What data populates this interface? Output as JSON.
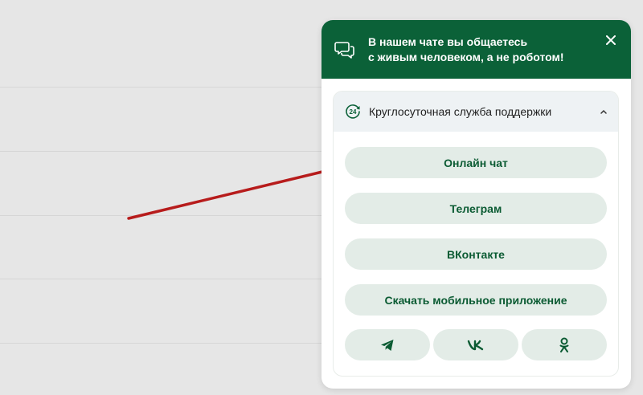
{
  "header": {
    "title_line1": "В нашем чате вы общаетесь",
    "title_line2": "с живым человеком, а не роботом!",
    "icon": "chat-bubbles-icon",
    "close_icon": "close-icon"
  },
  "support": {
    "title": "Круглосуточная служба поддержки",
    "icon": "24h-icon",
    "toggle_icon": "chevron-up-icon",
    "buttons": [
      {
        "label": "Онлайн чат"
      },
      {
        "label": "Телеграм"
      },
      {
        "label": "ВКонтакте"
      },
      {
        "label": "Скачать мобильное приложение"
      }
    ],
    "social": [
      {
        "icon": "telegram-icon"
      },
      {
        "icon": "vk-icon"
      },
      {
        "icon": "odnoklassniki-icon"
      }
    ]
  },
  "colors": {
    "brand_green": "#0b6138",
    "button_bg": "#e3ece7",
    "button_text": "#0b5b33",
    "arrow": "#b71c1c",
    "page_bg": "#e6e6e6"
  }
}
